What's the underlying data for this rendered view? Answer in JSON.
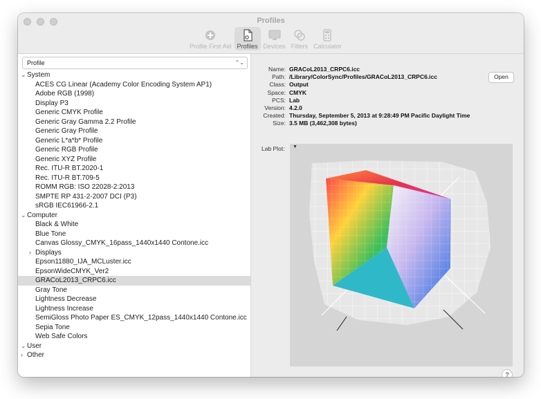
{
  "window": {
    "title": "Profiles"
  },
  "toolbar": {
    "items": [
      {
        "label": "Profile First Aid",
        "icon": "first-aid-icon"
      },
      {
        "label": "Profiles",
        "icon": "profiles-icon",
        "active": true
      },
      {
        "label": "Devices",
        "icon": "display-icon"
      },
      {
        "label": "Filters",
        "icon": "filters-icon"
      },
      {
        "label": "Calculator",
        "icon": "calculator-icon"
      }
    ]
  },
  "list": {
    "header": "Profile",
    "system_label": "System",
    "system_items": [
      "ACES CG Linear (Academy Color Encoding System AP1)",
      "Adobe RGB (1998)",
      "Display P3",
      "Generic CMYK Profile",
      "Generic Gray Gamma 2.2 Profile",
      "Generic Gray Profile",
      "Generic L*a*b* Profile",
      "Generic RGB Profile",
      "Generic XYZ Profile",
      "Rec. ITU-R BT.2020-1",
      "Rec. ITU-R BT.709-5",
      "ROMM RGB: ISO 22028-2:2013",
      "SMPTE RP 431-2-2007 DCI (P3)",
      "sRGB IEC61966-2.1"
    ],
    "computer_label": "Computer",
    "computer_items_a": [
      "Black & White",
      "Blue Tone",
      "Canvas Glossy_CMYK_16pass_1440x1440 Contone.icc"
    ],
    "displays_label": "Displays",
    "computer_items_b": [
      "Epson11880_IJA_MCLuster.icc",
      "EpsonWideCMYK_Ver2",
      "GRACoL2013_CRPC6.icc",
      "Gray Tone",
      "Lightness Decrease",
      "Lightness Increase",
      "SemiGloss Photo Paper ES_CMYK_12pass_1440x1440 Contone.icc",
      "Sepia Tone",
      "Web Safe Colors"
    ],
    "selected": "GRACoL2013_CRPC6.icc",
    "user_label": "User",
    "other_label": "Other"
  },
  "info": {
    "name_key": "Name:",
    "name": "GRACoL2013_CRPC6.icc",
    "path_key": "Path:",
    "path": "/Library/ColorSync/Profiles/GRACoL2013_CRPC6.icc",
    "class_key": "Class:",
    "class": "Output",
    "space_key": "Space:",
    "space": "CMYK",
    "pcs_key": "PCS:",
    "pcs": "Lab",
    "version_key": "Version:",
    "version": "4.2.0",
    "created_key": "Created:",
    "created": "Thursday, September 5, 2013 at 9:28:49 PM Pacific Daylight Time",
    "size_key": "Size:",
    "size": "3.5 MB (3,462,308 bytes)",
    "open_label": "Open",
    "plot_label": "Lab Plot:",
    "plot_menu": "▼",
    "help_label": "?"
  }
}
